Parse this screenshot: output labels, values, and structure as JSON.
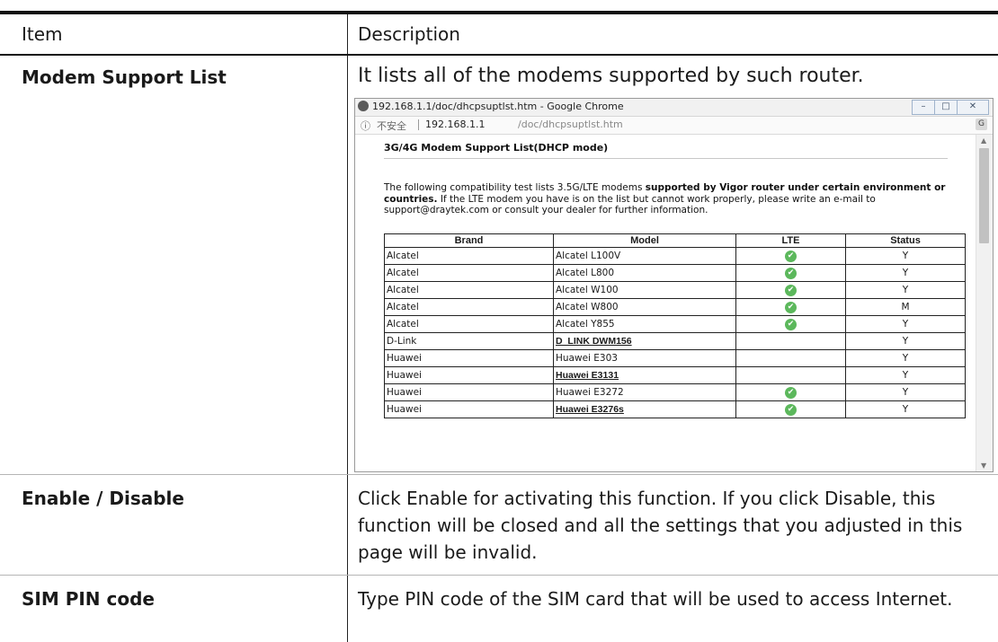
{
  "header": {
    "item": "Item",
    "description": "Description"
  },
  "rows": [
    {
      "item": "Modem Support List",
      "description": "It lists all of the modems supported by such router."
    },
    {
      "item": "Enable / Disable",
      "desc_p1": "Click ",
      "desc_enable": "Enable",
      "desc_p2": " for activating this function. If you click ",
      "desc_disable": "Disable",
      "desc_p3": ", this function will be closed and all the settings that you adjusted in this page will be invalid."
    },
    {
      "item": "SIM PIN code",
      "description": "Type PIN code of the SIM card that will be used to access Internet."
    }
  ],
  "screenshot": {
    "window_title": "192.168.1.1/doc/dhcpsuptlst.htm - Google Chrome",
    "insecure_label": "不安全",
    "url_host": "192.168.1.1",
    "url_path": "/doc/dhcpsuptlst.htm",
    "page_heading": "3G/4G Modem Support List(DHCP mode)",
    "intro_p1": "The following compatibility test lists 3.5G/LTE modems ",
    "intro_bold": "supported by Vigor router under certain environment or countries.",
    "intro_p2": " If the LTE modem you have is on the list but cannot work properly, please write an e-mail to support@draytek.com or consult your dealer for further information.",
    "columns": [
      "Brand",
      "Model",
      "LTE",
      "Status"
    ],
    "modems": [
      {
        "brand": "Alcatel",
        "model": "Alcatel L100V",
        "lte": true,
        "status": "Y",
        "link": false
      },
      {
        "brand": "Alcatel",
        "model": "Alcatel L800",
        "lte": true,
        "status": "Y",
        "link": false
      },
      {
        "brand": "Alcatel",
        "model": "Alcatel W100",
        "lte": true,
        "status": "Y",
        "link": false
      },
      {
        "brand": "Alcatel",
        "model": "Alcatel W800",
        "lte": true,
        "status": "M",
        "link": false
      },
      {
        "brand": "Alcatel",
        "model": "Alcatel Y855",
        "lte": true,
        "status": "Y",
        "link": false
      },
      {
        "brand": "D-Link",
        "model": "D_LINK DWM156",
        "lte": false,
        "status": "Y",
        "link": true
      },
      {
        "brand": "Huawei",
        "model": "Huawei E303",
        "lte": false,
        "status": "Y",
        "link": false
      },
      {
        "brand": "Huawei",
        "model": "Huawei E3131",
        "lte": false,
        "status": "Y",
        "link": true
      },
      {
        "brand": "Huawei",
        "model": "Huawei E3272",
        "lte": true,
        "status": "Y",
        "link": false
      },
      {
        "brand": "Huawei",
        "model": "Huawei E3276s",
        "lte": true,
        "status": "Y",
        "link": true
      }
    ]
  },
  "colors": {
    "check": "#5cb85c",
    "rule": "#111111"
  }
}
